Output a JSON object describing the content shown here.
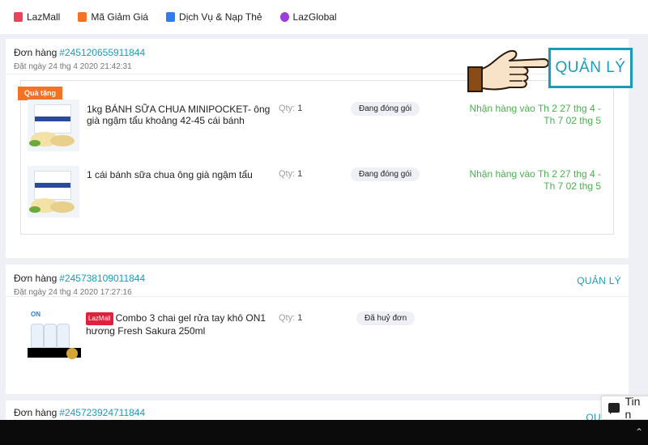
{
  "nav": {
    "items": [
      {
        "label": "LazMall",
        "icon": "lazmall-icon"
      },
      {
        "label": "Mã Giảm Giá",
        "icon": "voucher-icon"
      },
      {
        "label": "Dịch Vụ & Nạp Thẻ",
        "icon": "phone-topup-icon"
      },
      {
        "label": "LazGlobal",
        "icon": "globe-icon"
      }
    ]
  },
  "orders": [
    {
      "label": "Đơn hàng",
      "id": "#245120655911844",
      "date": "Đặt ngày 24 thg 4 2020 21:42:31",
      "manage": "QUẢN LÝ",
      "gift_tag": "Quà tặng",
      "items": [
        {
          "title": "1kg BÁNH SỮA CHUA MINIPOCKET- ông già ngậm tẩu khoảng 42-45 cái bánh",
          "qty_label": "Qty:",
          "qty": "1",
          "status": "Đang đóng gói",
          "delivery": "Nhận hàng vào Th 2 27 thg 4 - Th 7 02 thg 5"
        },
        {
          "title": "1 cái bánh sữa chua ông già ngậm tẩu",
          "qty_label": "Qty:",
          "qty": "1",
          "status": "Đang đóng gói",
          "delivery": "Nhận hàng vào Th 2 27 thg 4 - Th 7 02 thg 5"
        }
      ]
    },
    {
      "label": "Đơn hàng",
      "id": "#245738109011844",
      "date": "Đặt ngày 24 thg 4 2020 17:27:16",
      "manage": "QUẢN LÝ",
      "items": [
        {
          "badge": "LazMall",
          "title": "Combo 3 chai gel rửa tay khô ON1 hương Fresh Sakura 250ml",
          "qty_label": "Qty:",
          "qty": "1",
          "status": "Đã huỷ đơn"
        }
      ]
    },
    {
      "label": "Đơn hàng",
      "id": "#245723924711844",
      "manage": "QU"
    }
  ],
  "callout": {
    "manage_big": "QUẢN LÝ",
    "pointer": "pointing-hand-icon"
  },
  "chat": {
    "label": "Tin n"
  },
  "colors": {
    "accent": "#1a9cb7",
    "orange": "#f57224",
    "green": "#4caf50"
  }
}
